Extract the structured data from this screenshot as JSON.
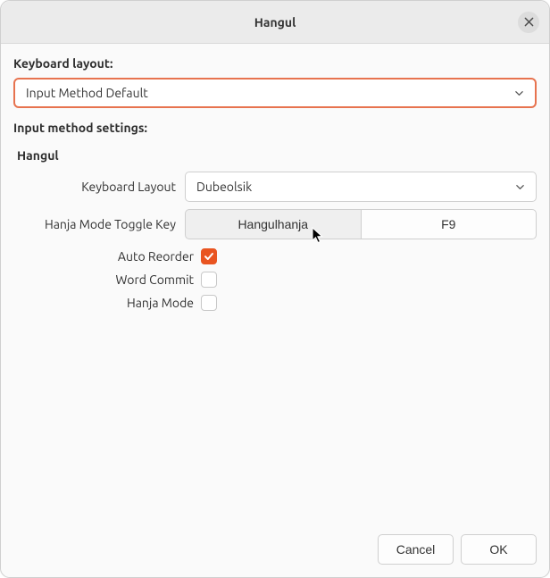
{
  "window": {
    "title": "Hangul"
  },
  "sections": {
    "keyboard_layout_label": "Keyboard layout:",
    "keyboard_layout_value": "Input Method Default",
    "input_method_settings_label": "Input method settings:"
  },
  "hangul": {
    "group_title": "Hangul",
    "rows": {
      "keyboard_layout": {
        "label": "Keyboard Layout",
        "value": "Dubeolsik"
      },
      "hanja_toggle": {
        "label": "Hanja Mode Toggle Key",
        "option_a": "Hangulhanja",
        "option_b": "F9"
      },
      "auto_reorder": {
        "label": "Auto Reorder",
        "checked": true
      },
      "word_commit": {
        "label": "Word Commit",
        "checked": false
      },
      "hanja_mode": {
        "label": "Hanja Mode",
        "checked": false
      }
    }
  },
  "footer": {
    "cancel": "Cancel",
    "ok": "OK"
  },
  "colors": {
    "accent": "#e95420",
    "primary_border": "#e7734f"
  }
}
